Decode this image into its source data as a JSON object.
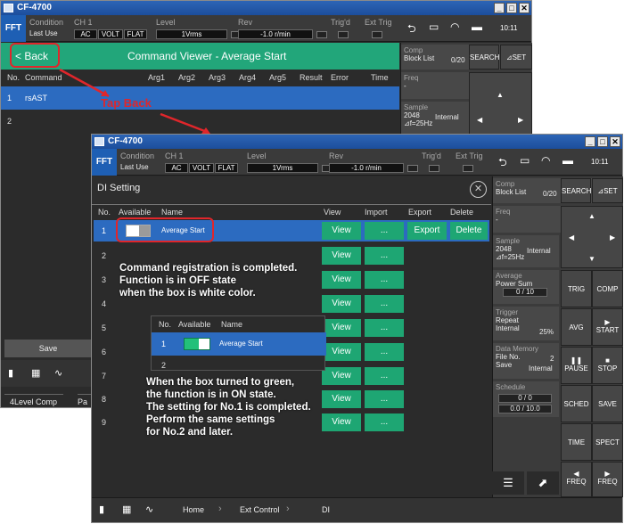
{
  "app": {
    "title": "CF-4700"
  },
  "header": {
    "mode": "FFT",
    "condition_label": "Condition",
    "condition_value": "Last Use",
    "ch_label": "CH 1",
    "ch_values": [
      "AC",
      "VOLT",
      "FLAT"
    ],
    "level_label": "Level",
    "level_value": "1Vrms",
    "rev_label": "Rev",
    "rev_value": "-1.0 r/min",
    "trigd_label": "Trig'd",
    "exttrig_label": "Ext Trig",
    "time": "10:11"
  },
  "back_window": {
    "back_label": "< Back",
    "title": "Command Viewer -  Average Start",
    "columns": [
      "No.",
      "Command",
      "Arg1",
      "Arg2",
      "Arg3",
      "Arg4",
      "Arg5",
      "Result",
      "Error",
      "Time"
    ],
    "rows": [
      {
        "no": "1",
        "command": "rsAST"
      },
      {
        "no": "2",
        "command": ""
      }
    ],
    "save_label": "Save",
    "bottom_tabs": [
      "4Level Comp",
      "Pa"
    ]
  },
  "right_panel": {
    "comp_label": "Comp",
    "block_list_label": "Block List",
    "block_list_value": "0/20",
    "search_label": "SEARCH",
    "set_label": "⊿SET",
    "freq_label": "Freq",
    "freq_value": "-",
    "sample_label": "Sample",
    "sample_value": "2048",
    "sample_mode": "Internal",
    "sample_df": "⊿f=25Hz",
    "average_label": "Average",
    "power_sum_label": "Power Sum",
    "average_count": "0 / 10",
    "trigger_label": "Trigger",
    "trigger_repeat": "Repeat",
    "trigger_internal": "Internal",
    "trigger_pct": "25%",
    "data_memory_label": "Data Memory",
    "file_no_label": "File No.",
    "file_no_value": "2",
    "save_label": "Save",
    "save_mode": "Internal",
    "schedule_label": "Schedule",
    "schedule_count": "0 / 0",
    "schedule_time": "0.0 / 10.0",
    "buttons": [
      "TRIG",
      "COMP",
      "AVG",
      "START",
      "PAUSE",
      "STOP",
      "SCHED",
      "SAVE",
      "TIME",
      "SPECT",
      "FREQ",
      "FREQ"
    ]
  },
  "di_window": {
    "title": "DI Setting",
    "columns": [
      "No.",
      "Available",
      "Name",
      "View",
      "Import",
      "Export",
      "Delete"
    ],
    "rows": [
      {
        "no": "1",
        "name": "Average Start",
        "view": "View",
        "import": "...",
        "export": "Export",
        "delete": "Delete"
      },
      {
        "no": "2",
        "name": "",
        "view": "View",
        "import": "..."
      },
      {
        "no": "3",
        "name": "",
        "view": "View",
        "import": "..."
      },
      {
        "no": "4",
        "name": "",
        "view": "View",
        "import": "..."
      },
      {
        "no": "5",
        "name": "",
        "view": "View",
        "import": "..."
      },
      {
        "no": "6",
        "name": "",
        "view": "View",
        "import": "..."
      },
      {
        "no": "7",
        "name": "",
        "view": "View",
        "import": "..."
      },
      {
        "no": "8",
        "name": "",
        "view": "View",
        "import": "..."
      },
      {
        "no": "9",
        "name": "",
        "view": "View",
        "import": "..."
      }
    ],
    "inset": {
      "columns": [
        "No.",
        "Available",
        "Name"
      ],
      "row1_no": "1",
      "row1_name": "Average Start",
      "row2_no": "2"
    },
    "breadcrumb": [
      "Home",
      "Ext Control",
      "DI"
    ]
  },
  "annotations": {
    "tap_back": "Tap Back",
    "callout1": [
      "Command registration is completed.",
      "Function is in OFF state",
      "when the box is white color."
    ],
    "callout2": [
      "When the box turned to green,",
      "the function is in ON state.",
      "The setting for No.1 is completed.",
      "Perform the same settings",
      "for No.2 and later."
    ]
  },
  "colors": {
    "accent_blue": "#2c6bc0",
    "green": "#1ea673",
    "annotation_red": "#e0262b"
  }
}
